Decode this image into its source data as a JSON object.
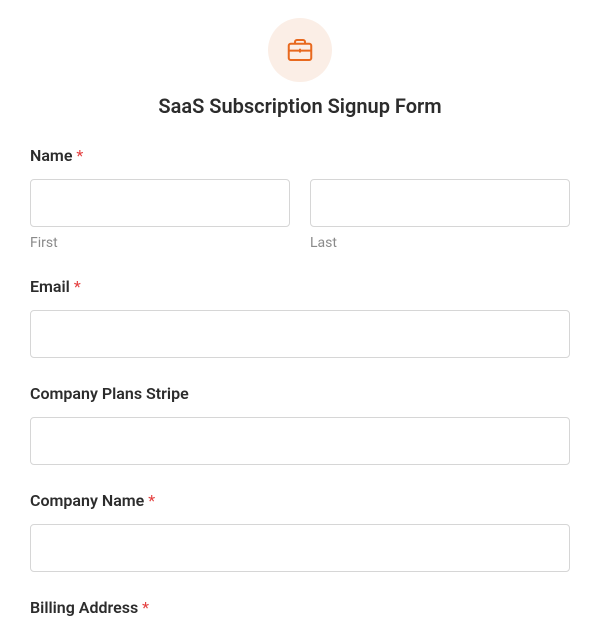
{
  "header": {
    "title": "SaaS Subscription Signup Form"
  },
  "fields": {
    "name": {
      "label": "Name",
      "required_mark": "*",
      "first_sublabel": "First",
      "last_sublabel": "Last"
    },
    "email": {
      "label": "Email",
      "required_mark": "*"
    },
    "plans": {
      "label": "Company Plans Stripe"
    },
    "company_name": {
      "label": "Company Name",
      "required_mark": "*"
    },
    "billing": {
      "label": "Billing Address",
      "required_mark": "*"
    }
  }
}
